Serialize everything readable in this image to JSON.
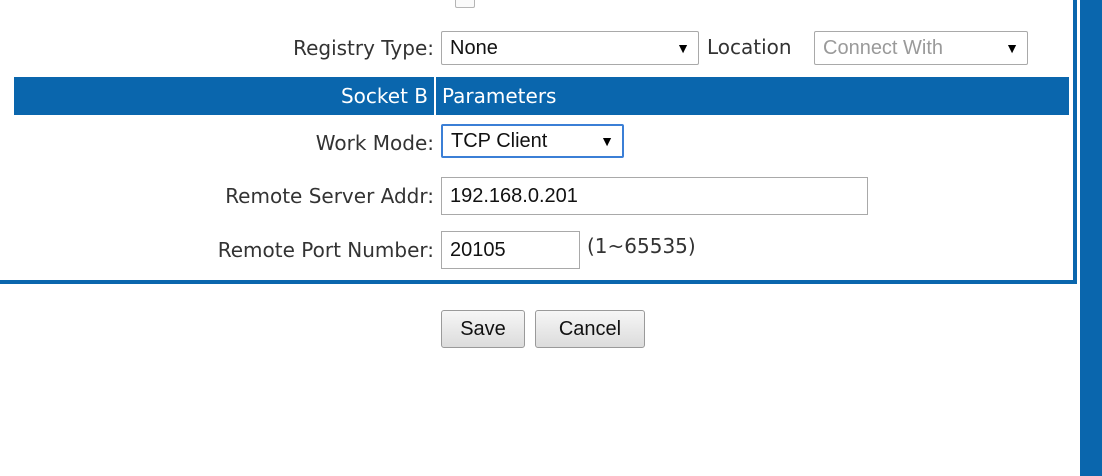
{
  "registry": {
    "label": "Registry Type:",
    "value": "None",
    "location_label": "Location",
    "location_value": "Connect With"
  },
  "section": {
    "left": "Socket B",
    "right": "Parameters"
  },
  "work_mode": {
    "label": "Work Mode:",
    "value": "TCP Client"
  },
  "remote_server": {
    "label": "Remote Server Addr:",
    "value": "192.168.0.201"
  },
  "remote_port": {
    "label": "Remote Port Number:",
    "value": "20105",
    "range_hint": "(1~65535)"
  },
  "buttons": {
    "save": "Save",
    "cancel": "Cancel"
  },
  "icons": {
    "dropdown": "dropdown-caret-icon",
    "checkbox": "checkbox-icon"
  },
  "colors": {
    "accent": "#0a66ad",
    "focus": "#3b7fd6"
  }
}
